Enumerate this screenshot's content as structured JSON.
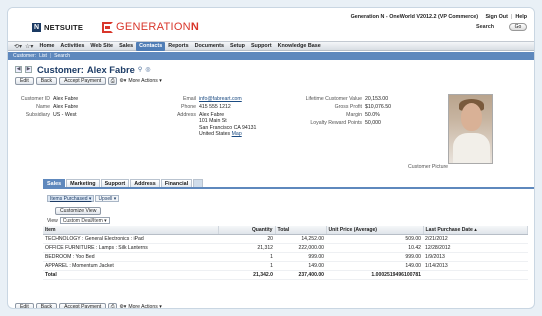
{
  "header": {
    "netsuite_logo": "NETSUITE",
    "brand_logo_prefix": "GENERATION",
    "brand_logo_suffix": "N",
    "account": "Generation N - OneWorld V2012.2 (VP Commerce)",
    "links": [
      "Sign Out",
      "Help"
    ],
    "search_label": "Search",
    "go_label": "Go"
  },
  "nav": {
    "items": [
      {
        "label": "Home",
        "active": false
      },
      {
        "label": "Activities",
        "active": false
      },
      {
        "label": "Web Site",
        "active": false
      },
      {
        "label": "Sales",
        "active": false
      },
      {
        "label": "Contacts",
        "active": true
      },
      {
        "label": "Reports",
        "active": false
      },
      {
        "label": "Documents",
        "active": false
      },
      {
        "label": "Setup",
        "active": false
      },
      {
        "label": "Support",
        "active": false
      },
      {
        "label": "Knowledge Base",
        "active": false
      }
    ],
    "subnav": [
      "Customer:",
      "List",
      "Search"
    ]
  },
  "record": {
    "type_label": "Customer:",
    "name": "Alex Fabre",
    "buttons": {
      "edit": "Edit",
      "back": "Back",
      "accept_payment": "Accept Payment",
      "more_actions": "More Actions"
    }
  },
  "fields": {
    "customer_id": {
      "label": "Customer ID",
      "value": "Alex Fabre"
    },
    "name": {
      "label": "Name",
      "value": "Alex Fabre"
    },
    "subsidiary": {
      "label": "Subsidiary",
      "value": "US - West"
    },
    "email": {
      "label": "Email",
      "value": "info@fabreart.com"
    },
    "phone": {
      "label": "Phone",
      "value": "415 555 1212"
    },
    "address": {
      "label": "Address",
      "lines": [
        "Alex Fabre",
        "101 Main St",
        "San Francisco CA 94131",
        "United States"
      ],
      "map_link": "Map"
    },
    "lifetime_value": {
      "label": "Lifetime Customer Value",
      "value": "20,153.00"
    },
    "gross_profit": {
      "label": "Gross Profit",
      "value": "$10,076.50"
    },
    "margin": {
      "label": "Margin",
      "value": "50.0%"
    },
    "loyalty": {
      "label": "Loyalty Reward Points",
      "value": "50,000"
    },
    "picture_caption": "Customer Picture"
  },
  "subtabs": [
    {
      "label": "Sales",
      "active": true
    },
    {
      "label": "Marketing",
      "active": false
    },
    {
      "label": "Support",
      "active": false
    },
    {
      "label": "Address",
      "active": false
    },
    {
      "label": "Financial",
      "active": false
    }
  ],
  "pills": [
    {
      "label": "Items Purchased",
      "active": true
    },
    {
      "label": "Upsell",
      "active": false
    }
  ],
  "customize_label": "Customize View",
  "view": {
    "label": "View",
    "selected": "Custom Deal/Item"
  },
  "table": {
    "headers": [
      "Item",
      "Quantity",
      "Total",
      "Unit Price (Average)",
      "Last Purchase Date"
    ],
    "rows": [
      [
        "TECHNOLOGY : General Electronics : iPad",
        "20",
        "14,252.00",
        "509.00",
        "2/21/2012"
      ],
      [
        "OFFICE FURNITURE : Lamps : Silk Lanterns",
        "21,312",
        "222,000.00",
        "10.42",
        "12/28/2012"
      ],
      [
        "BEDROOM : Yoo Bed",
        "1",
        "999.00",
        "999.00",
        "1/9/2013"
      ],
      [
        "APPAREL : Momentum Jacket",
        "1",
        "149.00",
        "149.00",
        "1/14/2013"
      ]
    ],
    "total": [
      "Total",
      "21,342.0",
      "237,400.00",
      "1.0002519496100781",
      ""
    ]
  }
}
